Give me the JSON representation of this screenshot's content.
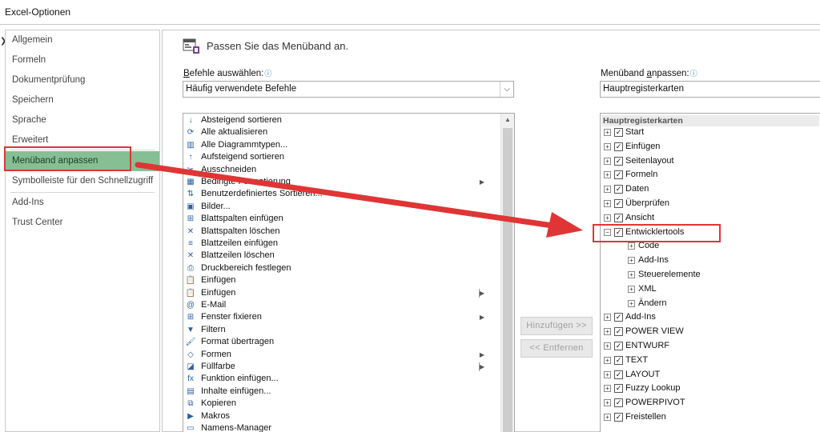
{
  "window": {
    "title": "Excel-Optionen"
  },
  "sidebar": {
    "items": [
      {
        "label": "Allgemein"
      },
      {
        "label": "Formeln"
      },
      {
        "label": "Dokumentprüfung"
      },
      {
        "label": "Speichern"
      },
      {
        "label": "Sprache"
      },
      {
        "label": "Erweitert"
      },
      {
        "label": "Menüband anpassen",
        "selected": true
      },
      {
        "label": "Symbolleiste für den Schnellzugriff"
      },
      {
        "label": "Add-Ins"
      },
      {
        "label": "Trust Center"
      }
    ]
  },
  "main": {
    "header_icon": "customize-ribbon-icon",
    "title": "Passen Sie das Menüband an.",
    "commands_label_first": "B",
    "commands_label_rest": "efehle auswählen:",
    "commands_select_value": "Häufig verwendete Befehle",
    "ribbon_label_first": "Menüband ",
    "ribbon_label_u": "a",
    "ribbon_label_rest": "npassen:",
    "ribbon_select_value": "Hauptregisterkarten",
    "add_button": "Hinzufügen >>",
    "remove_button": "<< Entfernen"
  },
  "commands": [
    {
      "label": "Absteigend sortieren",
      "icon": "sort-desc-icon",
      "glyph": "↓"
    },
    {
      "label": "Alle aktualisieren",
      "icon": "refresh-all-icon",
      "glyph": "⟳"
    },
    {
      "label": "Alle Diagrammtypen...",
      "icon": "chart-icon",
      "glyph": "▥"
    },
    {
      "label": "Aufsteigend sortieren",
      "icon": "sort-asc-icon",
      "glyph": "↑"
    },
    {
      "label": "Ausschneiden",
      "icon": "cut-icon",
      "glyph": "✂"
    },
    {
      "label": "Bedingte Formatierung",
      "icon": "conditional-format-icon",
      "glyph": "▦",
      "submenu": true
    },
    {
      "label": "Benutzerdefiniertes Sortieren...",
      "icon": "custom-sort-icon",
      "glyph": "⇅"
    },
    {
      "label": "Bilder...",
      "icon": "picture-icon",
      "glyph": "▣"
    },
    {
      "label": "Blattspalten einfügen",
      "icon": "insert-columns-icon",
      "glyph": "⊞"
    },
    {
      "label": "Blattspalten löschen",
      "icon": "delete-columns-icon",
      "glyph": "✕"
    },
    {
      "label": "Blattzeilen einfügen",
      "icon": "insert-rows-icon",
      "glyph": "≡"
    },
    {
      "label": "Blattzeilen löschen",
      "icon": "delete-rows-icon",
      "glyph": "✕"
    },
    {
      "label": "Druckbereich festlegen",
      "icon": "print-area-icon",
      "glyph": "⎙"
    },
    {
      "label": "Einfügen",
      "icon": "paste-icon",
      "glyph": "📋"
    },
    {
      "label": "Einfügen",
      "icon": "paste-options-icon",
      "glyph": "📋",
      "submenu": true,
      "bar": true
    },
    {
      "label": "E-Mail",
      "icon": "email-icon",
      "glyph": "@"
    },
    {
      "label": "Fenster fixieren",
      "icon": "freeze-panes-icon",
      "glyph": "⊞",
      "submenu": true
    },
    {
      "label": "Filtern",
      "icon": "filter-icon",
      "glyph": "▼"
    },
    {
      "label": "Format übertragen",
      "icon": "format-painter-icon",
      "glyph": "🖌"
    },
    {
      "label": "Formen",
      "icon": "shapes-icon",
      "glyph": "◇",
      "submenu": true
    },
    {
      "label": "Füllfarbe",
      "icon": "fill-color-icon",
      "glyph": "◪",
      "submenu": true,
      "bar": true
    },
    {
      "label": "Funktion einfügen...",
      "icon": "insert-function-icon",
      "glyph": "fx"
    },
    {
      "label": "Inhalte einfügen...",
      "icon": "paste-special-icon",
      "glyph": "▤"
    },
    {
      "label": "Kopieren",
      "icon": "copy-icon",
      "glyph": "⧉"
    },
    {
      "label": "Makros",
      "icon": "macros-icon",
      "glyph": "▶"
    },
    {
      "label": "Namens-Manager",
      "icon": "name-manager-icon",
      "glyph": "▭"
    }
  ],
  "tree": {
    "header": "Hauptregisterkarten",
    "items": [
      {
        "label": "Start",
        "level": 0,
        "checkbox": true
      },
      {
        "label": "Einfügen",
        "level": 0,
        "checkbox": true
      },
      {
        "label": "Seitenlayout",
        "level": 0,
        "checkbox": true
      },
      {
        "label": "Formeln",
        "level": 0,
        "checkbox": true
      },
      {
        "label": "Daten",
        "level": 0,
        "checkbox": true
      },
      {
        "label": "Überprüfen",
        "level": 0,
        "checkbox": true
      },
      {
        "label": "Ansicht",
        "level": 0,
        "checkbox": true
      },
      {
        "label": "Entwicklertools",
        "level": 0,
        "checkbox": true,
        "expanded": true,
        "highlighted": true
      },
      {
        "label": "Code",
        "level": 1,
        "checkbox": false
      },
      {
        "label": "Add-Ins",
        "level": 1,
        "checkbox": false
      },
      {
        "label": "Steuerelemente",
        "level": 1,
        "checkbox": false
      },
      {
        "label": "XML",
        "level": 1,
        "checkbox": false
      },
      {
        "label": "Ändern",
        "level": 1,
        "checkbox": false
      },
      {
        "label": "Add-Ins",
        "level": 0,
        "checkbox": true
      },
      {
        "label": "POWER VIEW",
        "level": 0,
        "checkbox": true
      },
      {
        "label": "ENTWURF",
        "level": 0,
        "checkbox": true
      },
      {
        "label": "TEXT",
        "level": 0,
        "checkbox": true
      },
      {
        "label": "LAYOUT",
        "level": 0,
        "checkbox": true
      },
      {
        "label": "Fuzzy Lookup",
        "level": 0,
        "checkbox": true
      },
      {
        "label": "POWERPIVOT",
        "level": 0,
        "checkbox": true
      },
      {
        "label": "Freistellen",
        "level": 0,
        "checkbox": true
      }
    ]
  },
  "colors": {
    "annotation_red": "#e03535",
    "selected_nav": "#86bf94"
  }
}
